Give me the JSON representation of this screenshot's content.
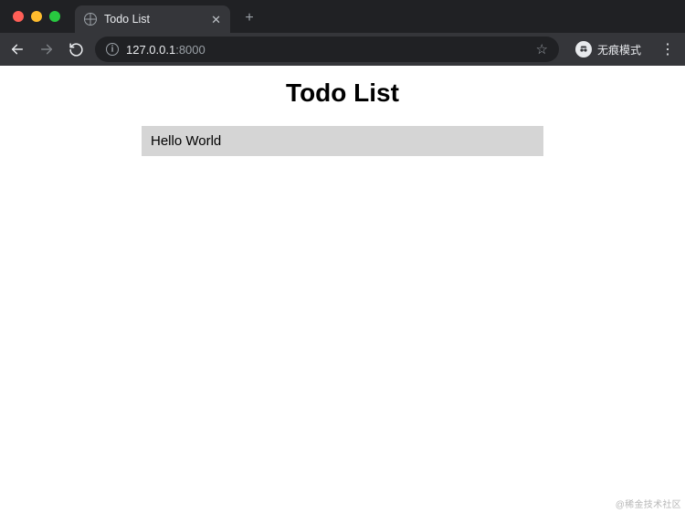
{
  "browser": {
    "tab_title": "Todo List",
    "url_main": "127.0.0.1",
    "url_port": ":8000",
    "profile_label": "无痕模式"
  },
  "page": {
    "heading": "Todo List",
    "items": [
      "Hello World"
    ]
  },
  "watermark": "@稀金技术社区"
}
